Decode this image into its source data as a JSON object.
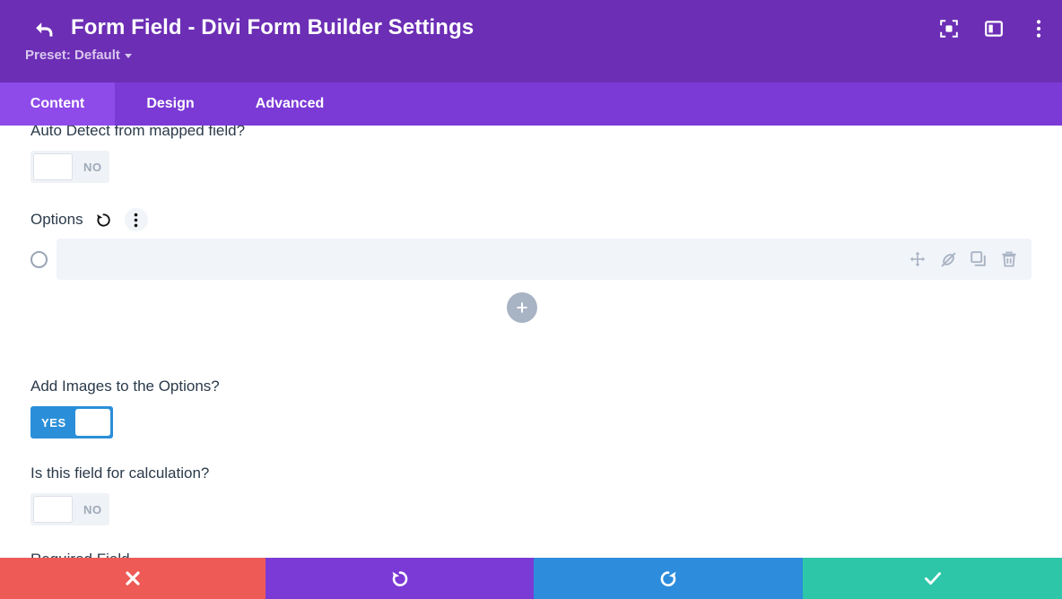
{
  "header": {
    "back_icon": "back-arrow-icon",
    "title": "Form Field - Divi Form Builder Settings",
    "preset_label": "Preset: Default",
    "actions": [
      {
        "name": "focus-frame-icon",
        "label": "Focus"
      },
      {
        "name": "layout-panel-icon",
        "label": "Layout"
      },
      {
        "name": "more-vertical-icon",
        "label": "More"
      }
    ],
    "bg_color": "#6C2EB5"
  },
  "tabs": {
    "active_index": 0,
    "items": [
      {
        "label": "Content"
      },
      {
        "label": "Design"
      },
      {
        "label": "Advanced"
      }
    ],
    "bg_color": "#7B39D6",
    "active_color": "#8E4BEA"
  },
  "main": {
    "fields": [
      {
        "label": "Auto Detect from mapped field?",
        "control": "toggle",
        "state": "off",
        "state_label": "NO"
      },
      {
        "label": "Options",
        "control": "options-list",
        "reset_icon": "reset-icon",
        "menu_icon": "more-vertical-icon",
        "rows": [
          {
            "radio_selected": false,
            "value": "",
            "placeholder": "",
            "tools": [
              {
                "name": "move-icon"
              },
              {
                "name": "disable-link-icon"
              },
              {
                "name": "duplicate-icon"
              },
              {
                "name": "delete-icon"
              }
            ]
          }
        ],
        "add_label": "+"
      },
      {
        "label": "Add Images to the Options?",
        "control": "toggle",
        "state": "on",
        "state_label": "YES",
        "on_color": "#2A8FD8"
      },
      {
        "label": "Is this field for calculation?",
        "control": "toggle",
        "state": "off",
        "state_label": "NO"
      },
      {
        "label": "Required Field",
        "control": "toggle",
        "state": "off",
        "state_label": ""
      }
    ]
  },
  "bottombar": {
    "buttons": [
      {
        "name": "cancel-button",
        "icon": "close-icon",
        "color": "#EE5A56"
      },
      {
        "name": "undo-button",
        "icon": "undo-icon",
        "color": "#7B39D6"
      },
      {
        "name": "redo-button",
        "icon": "redo-icon",
        "color": "#2D8CDC"
      },
      {
        "name": "save-button",
        "icon": "check-icon",
        "color": "#2EC6A8"
      }
    ]
  }
}
